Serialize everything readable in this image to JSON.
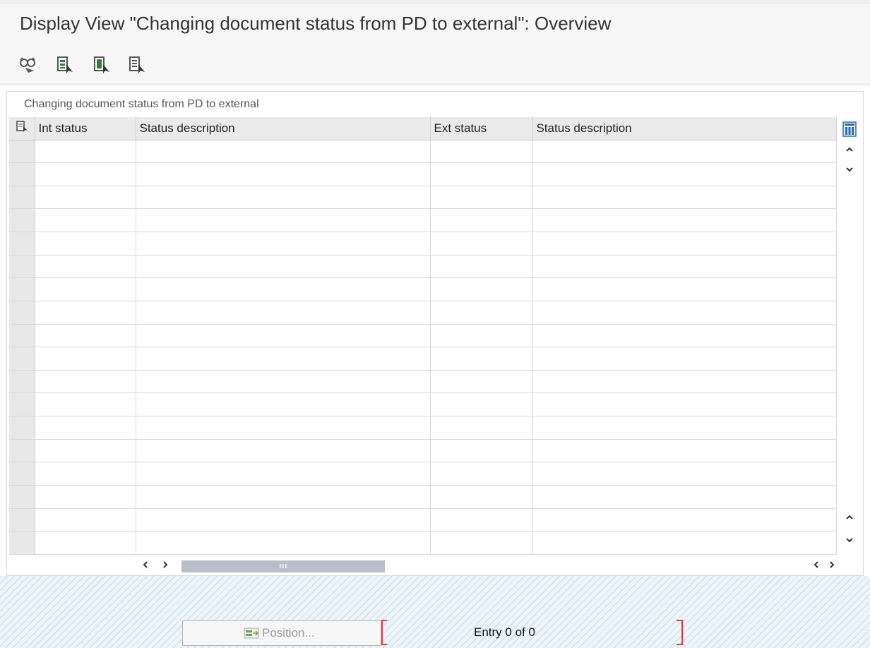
{
  "window": {
    "title": "Display View \"Changing document status from PD to external\": Overview"
  },
  "toolbar": {
    "buttons": [
      {
        "icon": "glasses-icon",
        "label": ""
      },
      {
        "icon": "select-all-icon",
        "label": ""
      },
      {
        "icon": "select-block-icon",
        "label": ""
      },
      {
        "icon": "deselect-all-icon",
        "label": ""
      }
    ]
  },
  "table": {
    "caption": "Changing document status from PD to external",
    "columns": [
      "Int status",
      "Status description",
      "Ext status",
      "Status description"
    ],
    "rows": []
  },
  "footer": {
    "position_button": "Position...",
    "entry_text": "Entry 0 of 0"
  },
  "colors": {
    "header_bg": "#eaeaea",
    "scroll_thumb": "#b7c0c8",
    "footer_pattern": "#bed7e8",
    "accent_red": "#e53935"
  }
}
